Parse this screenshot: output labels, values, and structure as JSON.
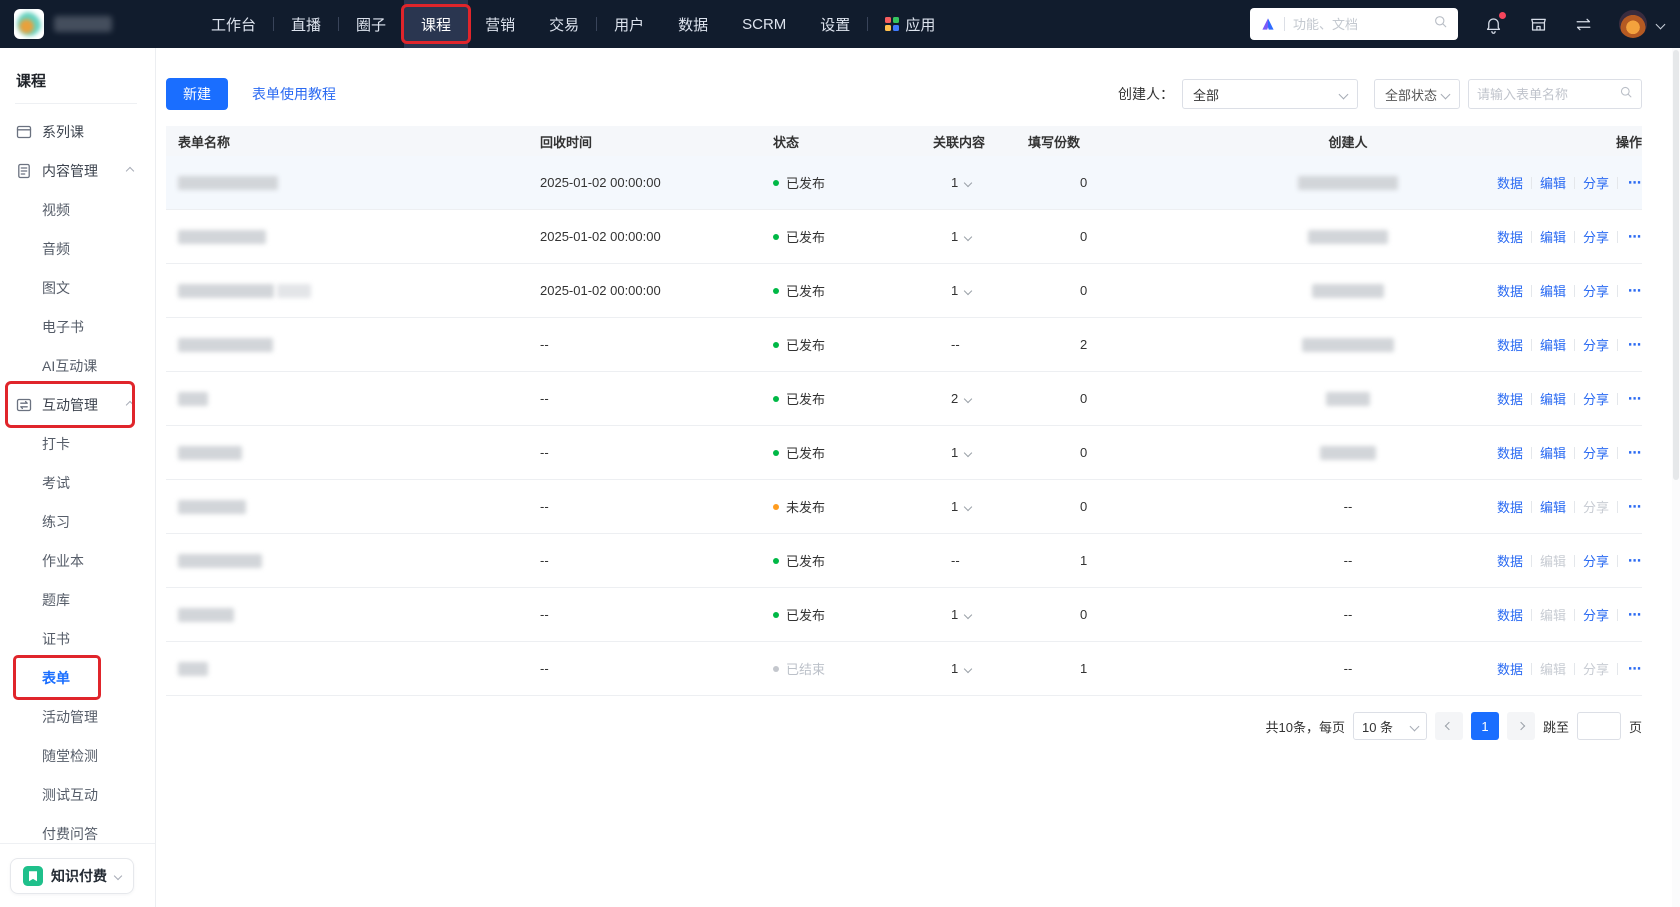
{
  "annotation_color": "#e0252b",
  "header": {
    "search_placeholder": "功能、文档",
    "nav": [
      {
        "label": "工作台",
        "divider": true
      },
      {
        "label": "直播",
        "divider": true
      },
      {
        "label": "圈子",
        "divider": true
      },
      {
        "label": "课程",
        "selected": true,
        "annotated": true
      },
      {
        "label": "营销"
      },
      {
        "label": "交易",
        "divider": true
      },
      {
        "label": "用户"
      },
      {
        "label": "数据"
      },
      {
        "label": "SCRM"
      },
      {
        "label": "设置",
        "divider": true
      },
      {
        "label": "应用",
        "apps_icon": true
      }
    ]
  },
  "sidebar": {
    "title": "课程",
    "bottom_switcher": "知识付费",
    "items": [
      {
        "label": "系列课",
        "icon": "series-icon",
        "level": 0
      },
      {
        "label": "内容管理",
        "icon": "content-icon",
        "level": 0,
        "expandable": true
      },
      {
        "label": "视频",
        "level": 1
      },
      {
        "label": "音频",
        "level": 1
      },
      {
        "label": "图文",
        "level": 1
      },
      {
        "label": "电子书",
        "level": 1
      },
      {
        "label": "AI互动课",
        "level": 1
      },
      {
        "label": "互动管理",
        "icon": "interact-icon",
        "level": 0,
        "expandable": true,
        "annotated": true
      },
      {
        "label": "打卡",
        "level": 1
      },
      {
        "label": "考试",
        "level": 1
      },
      {
        "label": "练习",
        "level": 1
      },
      {
        "label": "作业本",
        "level": 1
      },
      {
        "label": "题库",
        "level": 1
      },
      {
        "label": "证书",
        "level": 1
      },
      {
        "label": "表单",
        "level": 1,
        "selected": true,
        "annotated": true
      },
      {
        "label": "活动管理",
        "level": 1
      },
      {
        "label": "随堂检测",
        "level": 1
      },
      {
        "label": "测试互动",
        "level": 1
      },
      {
        "label": "付费问答",
        "level": 1,
        "clipped": true
      }
    ]
  },
  "toolbar": {
    "new_button": "新建",
    "tutorial_link": "表单使用教程",
    "creator_label": "创建人：",
    "creator_value": "全部",
    "status_filter": "全部状态",
    "search_placeholder": "请输入表单名称"
  },
  "table": {
    "columns": [
      "表单名称",
      "回收时间",
      "状态",
      "关联内容",
      "填写份数",
      "创建人",
      "操作"
    ],
    "action_labels": {
      "data": "数据",
      "edit": "编辑",
      "share": "分享",
      "more": "⋯"
    },
    "status_colors": {
      "published": "#00b846",
      "unpublished": "#ff9c1e",
      "ended": "#c4c7cd"
    },
    "rows": [
      {
        "name_blur": [
          100
        ],
        "time": "2025-01-02 00:00:00",
        "status": "已发布",
        "status_type": "published",
        "related": "1",
        "related_expand": true,
        "count": "0",
        "creator_blur": 100,
        "highlight": true
      },
      {
        "name_blur": [
          88
        ],
        "time": "2025-01-02 00:00:00",
        "status": "已发布",
        "status_type": "published",
        "related": "1",
        "related_expand": true,
        "count": "0",
        "creator_blur": 80
      },
      {
        "name_blur": [
          96,
          34
        ],
        "time": "2025-01-02 00:00:00",
        "status": "已发布",
        "status_type": "published",
        "related": "1",
        "related_expand": true,
        "count": "0",
        "creator_blur": 72
      },
      {
        "name_blur": [
          95
        ],
        "time": "--",
        "status": "已发布",
        "status_type": "published",
        "related": "--",
        "related_expand": false,
        "count": "2",
        "creator_blur": 92
      },
      {
        "name_blur": [
          30
        ],
        "time": "--",
        "status": "已发布",
        "status_type": "published",
        "related": "2",
        "related_expand": true,
        "count": "0",
        "creator_blur": 44
      },
      {
        "name_blur": [
          64
        ],
        "time": "--",
        "status": "已发布",
        "status_type": "published",
        "related": "1",
        "related_expand": true,
        "count": "0",
        "creator_blur": 56
      },
      {
        "name_blur": [
          68
        ],
        "time": "--",
        "status": "未发布",
        "status_type": "unpublished",
        "related": "1",
        "related_expand": true,
        "count": "0",
        "creator": "--",
        "share_disabled": true
      },
      {
        "name_blur": [
          84
        ],
        "time": "--",
        "status": "已发布",
        "status_type": "published",
        "related": "--",
        "related_expand": false,
        "count": "1",
        "creator": "--",
        "edit_disabled": true
      },
      {
        "name_blur": [
          56
        ],
        "time": "--",
        "status": "已发布",
        "status_type": "published",
        "related": "1",
        "related_expand": true,
        "count": "0",
        "creator": "--",
        "edit_disabled": true
      },
      {
        "name_blur": [
          30
        ],
        "time": "--",
        "status": "已结束",
        "status_type": "ended",
        "related": "1",
        "related_expand": true,
        "count": "1",
        "creator": "--",
        "edit_disabled": true,
        "share_disabled": true
      }
    ]
  },
  "pagination": {
    "total_text": "共10条，每页",
    "page_size": "10 条",
    "current_page": "1",
    "jump_label": "跳至",
    "page_unit": "页"
  }
}
